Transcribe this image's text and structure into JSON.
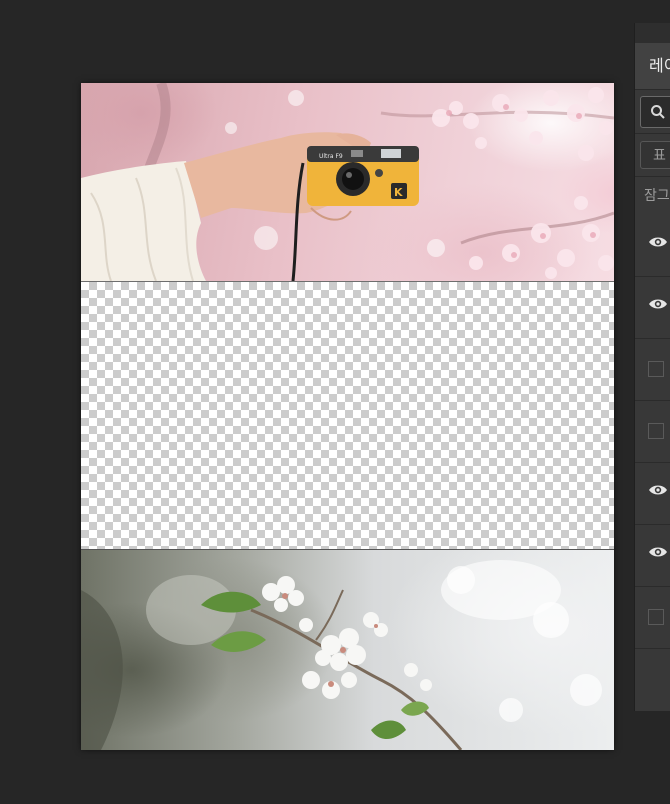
{
  "panel": {
    "tab_label": "레이",
    "blend_mode": "표",
    "lock_label": "잠그",
    "search_icon": "search-icon"
  },
  "layers": [
    {
      "visible": true
    },
    {
      "visible": true
    },
    {
      "visible": false
    },
    {
      "visible": false
    },
    {
      "visible": true
    },
    {
      "visible": true
    },
    {
      "visible": false
    }
  ],
  "canvas": {
    "camera_brand": "Ultra F9",
    "camera_logo": "K"
  },
  "colors": {
    "app_background": "#262626",
    "panel_background": "#383838",
    "camera_yellow": "#f0b43a"
  }
}
